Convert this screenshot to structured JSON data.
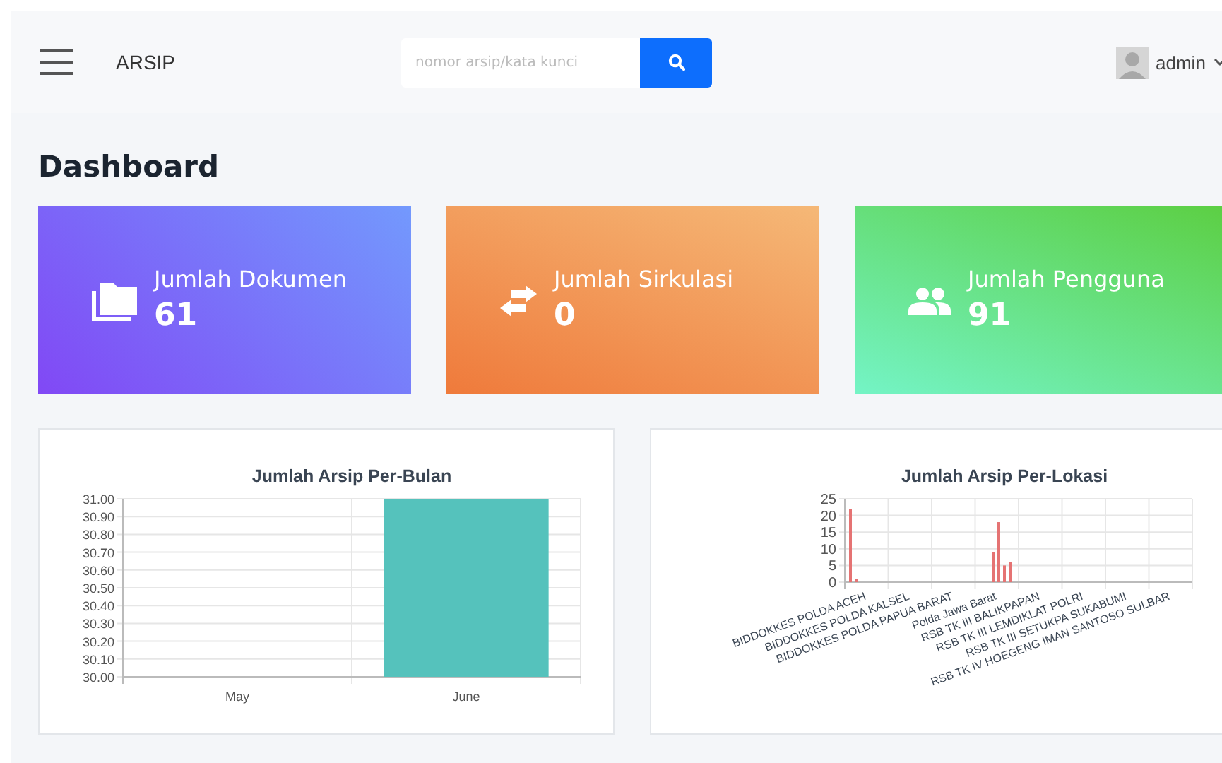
{
  "navbar": {
    "brand": "ARSIP",
    "search": {
      "placeholder": "nomor arsip/kata kunci"
    },
    "user": "admin"
  },
  "page_title": "Dashboard",
  "stats": [
    {
      "kind": "documents",
      "label": "Jumlah Dokumen",
      "value": "61"
    },
    {
      "kind": "circulation",
      "label": "Jumlah Sirkulasi",
      "value": "0"
    },
    {
      "kind": "users",
      "label": "Jumlah Pengguna",
      "value": "91"
    }
  ],
  "charts": [
    {
      "chart_data": {
        "type": "bar",
        "title": "Jumlah Arsip Per-Bulan",
        "categories": [
          "May",
          "June"
        ],
        "series": [
          {
            "color": "#55c2bc",
            "values": [
              null,
              31
            ]
          }
        ],
        "grid": true,
        "ylim": [
          30,
          31
        ],
        "yticks": [
          {
            "value": 30,
            "label": "30.00"
          },
          {
            "value": 30.1,
            "label": "30.10"
          },
          {
            "value": 30.2,
            "label": "30.20"
          },
          {
            "value": 30.3,
            "label": "30.30"
          },
          {
            "value": 30.4,
            "label": "30.40"
          },
          {
            "value": 30.5,
            "label": "30.50"
          },
          {
            "value": 30.6,
            "label": "30.60"
          },
          {
            "value": 30.7,
            "label": "30.70"
          },
          {
            "value": 30.8,
            "label": "30.80"
          },
          {
            "value": 30.9,
            "label": "30.90"
          },
          {
            "value": 31,
            "label": "31.00"
          }
        ]
      }
    },
    {
      "chart_data": {
        "type": "bar",
        "title": "Jumlah Arsip Per-Lokasi",
        "categories": [
          "BIDDOKKES POLDA ACEH",
          "BIDDOKKES POLDA KALSEL",
          "BIDDOKKES POLDA PAPUA BARAT",
          "Polda Jawa Barat",
          "RSB TK III BALIKPAPAN",
          "RSB TK III LEMDIKLAT POLRI",
          "RSB TK III SETUKPA SUKABUMI",
          "RSB TK IV HOEGENG IMAN SANTOSO SULBAR"
        ],
        "series": [
          {
            "color": "#e57373",
            "values": [
              22,
              null,
              null,
              null,
              null,
              null,
              null,
              null
            ]
          },
          {
            "color": "#e57373",
            "values": [
              1,
              null,
              null,
              null,
              null,
              null,
              null,
              null
            ]
          },
          {
            "color": "#e57373",
            "values": [
              null,
              null,
              null,
              9,
              null,
              null,
              null,
              null
            ]
          },
          {
            "color": "#e57373",
            "values": [
              null,
              null,
              null,
              18,
              null,
              null,
              null,
              null
            ]
          },
          {
            "color": "#e57373",
            "values": [
              null,
              null,
              null,
              5,
              null,
              null,
              null,
              null
            ]
          },
          {
            "color": "#e57373",
            "values": [
              null,
              null,
              null,
              6,
              null,
              null,
              null,
              null
            ]
          }
        ],
        "grid": true,
        "ylim": [
          0,
          25
        ],
        "yticks": [
          0,
          5,
          10,
          15,
          20,
          25
        ]
      }
    }
  ]
}
